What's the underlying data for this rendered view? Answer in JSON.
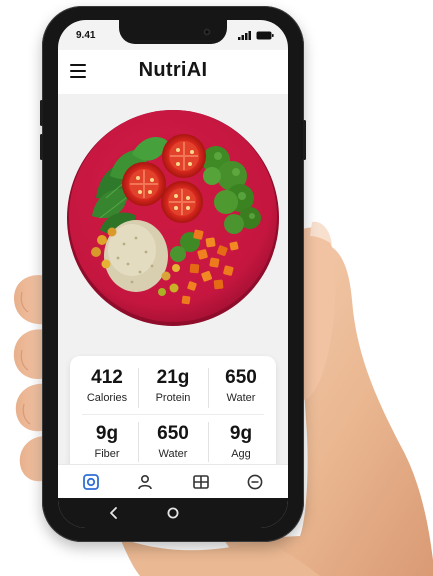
{
  "status_bar": {
    "time": "9.41"
  },
  "header": {
    "title": "NutriAI",
    "menu_icon": "hamburger-menu-icon"
  },
  "meal": {
    "image": "salad-plate-image",
    "colors": {
      "plate": "#c4163f",
      "tomato": "#d6281e",
      "broccoli": "#3f8a25",
      "carrot": "#ee7a1e",
      "quinoa": "#d8cfb0"
    }
  },
  "nutrition": {
    "row1": [
      {
        "value": "412",
        "label": "Calories"
      },
      {
        "value": "21g",
        "label": "Protein"
      },
      {
        "value": "650",
        "label": "Water"
      }
    ],
    "row2": [
      {
        "value": "9g",
        "label": "Fiber"
      },
      {
        "value": "650",
        "label": "Water"
      },
      {
        "value": "9g",
        "label": "Agg"
      }
    ]
  },
  "bottom_nav": {
    "items": [
      {
        "icon": "camera-icon",
        "active": true
      },
      {
        "icon": "profile-icon",
        "active": false
      },
      {
        "icon": "dashboard-icon",
        "active": false
      },
      {
        "icon": "minus-circle-icon",
        "active": false
      }
    ],
    "active_color": "#2f6fd6"
  },
  "system_nav": {
    "items": [
      "back-icon",
      "home-icon"
    ]
  }
}
